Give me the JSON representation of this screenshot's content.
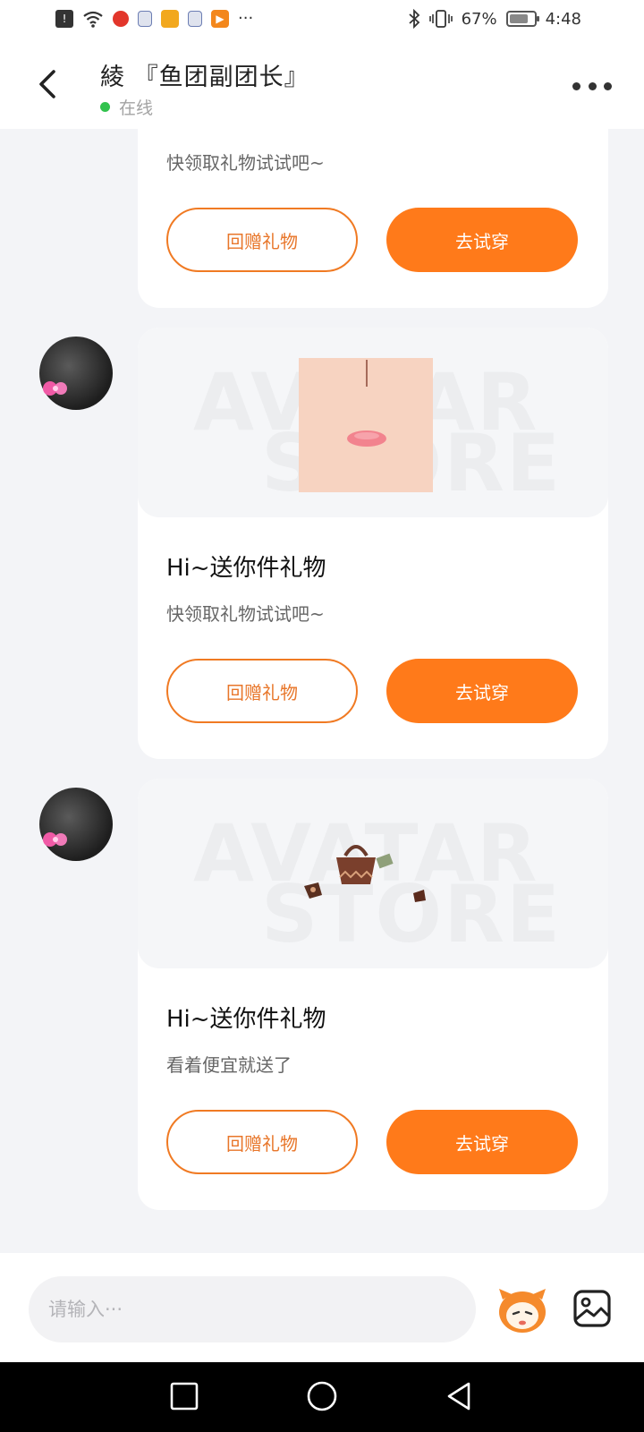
{
  "status_bar": {
    "battery_percent": "67%",
    "time": "4:48",
    "more": "···"
  },
  "header": {
    "title": "綾 『鱼团副团长』",
    "status": "在线"
  },
  "messages": [
    {
      "subtitle": "快领取礼物试试吧~",
      "return_gift_label": "回赠礼物",
      "try_on_label": "去试穿"
    },
    {
      "watermark_line1": "AVATAR",
      "watermark_line2": "STORE",
      "title": "Hi~送你件礼物",
      "subtitle": "快领取礼物试试吧~",
      "return_gift_label": "回赠礼物",
      "try_on_label": "去试穿",
      "icon": "face-makeup"
    },
    {
      "watermark_line1": "AVATAR",
      "watermark_line2": "STORE",
      "title": "Hi~送你件礼物",
      "subtitle": "看着便宜就送了",
      "return_gift_label": "回赠礼物",
      "try_on_label": "去试穿",
      "icon": "brown-handbag"
    }
  ],
  "input": {
    "placeholder": "请输入···"
  },
  "colors": {
    "accent": "#ff7a1a",
    "online": "#31c24d"
  }
}
